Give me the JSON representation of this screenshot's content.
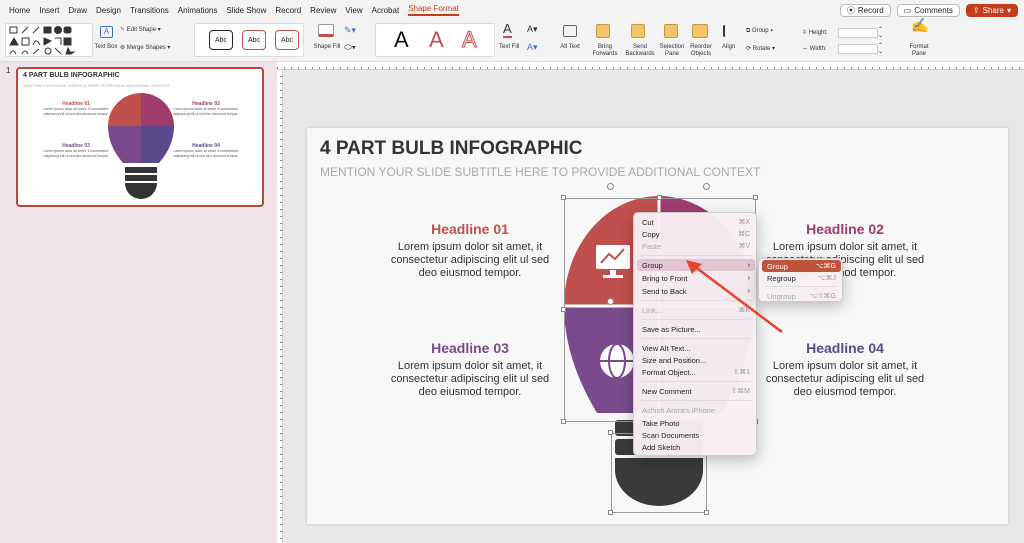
{
  "tabs": [
    "Home",
    "Insert",
    "Draw",
    "Design",
    "Transitions",
    "Animations",
    "Slide Show",
    "Record",
    "Review",
    "View",
    "Acrobat",
    "Shape Format"
  ],
  "top_right": {
    "record": "Record",
    "comments": "Comments",
    "share": "Share"
  },
  "ribbon": {
    "text_box": "Text Box",
    "edit_shape": "Edit Shape",
    "merge_shapes": "Merge Shapes",
    "style_sample": "Abc",
    "shape_fill": "Shape Fill",
    "text_fill": "Text Fill",
    "alt_text": "Alt Text",
    "bring_forwards": "Bring Forwards",
    "send_backwards": "Send Backwards",
    "selection_pane": "Selection Pane",
    "reorder_objects": "Reorder Objects",
    "align": "Align",
    "group": "Group",
    "rotate": "Rotate",
    "height": "Height:",
    "width": "Width:",
    "format_pane": "Format Pane",
    "wordart_a": "A"
  },
  "slide_number": "1",
  "slide": {
    "title": "4 PART BULB INFOGRAPHIC",
    "subtitle": "MENTION YOUR SLIDE SUBTITLE HERE TO PROVIDE ADDITIONAL CONTEXT",
    "body": "Lorem ipsum dolor sit amet, it consectetur adipiscing elit ul sed deo eiusmod tempor.",
    "h1": "Headline 01",
    "h2": "Headline 02",
    "h3": "Headline 03",
    "h4": "Headline 04"
  },
  "colors": {
    "h1": "#c0504d",
    "h2": "#9e3c6e",
    "h3": "#7a4a8c",
    "h4": "#5a4a8c",
    "accent": "#c43e1c"
  },
  "context_menu": [
    {
      "label": "Cut",
      "shortcut": "⌘X",
      "disabled": false
    },
    {
      "label": "Copy",
      "shortcut": "⌘C",
      "disabled": false
    },
    {
      "label": "Paste",
      "shortcut": "⌘V",
      "disabled": true
    },
    {
      "label": "Group",
      "shortcut": "›",
      "disabled": false
    },
    {
      "label": "Bring to Front",
      "shortcut": "›",
      "disabled": false
    },
    {
      "label": "Send to Back",
      "shortcut": "›",
      "disabled": false
    },
    {
      "label": "Link...",
      "shortcut": "⌘K",
      "disabled": true
    },
    {
      "label": "Save as Picture...",
      "shortcut": "",
      "disabled": false
    },
    {
      "label": "View Alt Text...",
      "shortcut": "",
      "disabled": false
    },
    {
      "label": "Size and Position...",
      "shortcut": "",
      "disabled": false
    },
    {
      "label": "Format Object...",
      "shortcut": "⇧⌘1",
      "disabled": false
    },
    {
      "label": "New Comment",
      "shortcut": "⇧⌘M",
      "disabled": false
    },
    {
      "label": "Ashish Arora's iPhone",
      "shortcut": "",
      "disabled": true
    },
    {
      "label": "Take Photo",
      "shortcut": "",
      "disabled": false
    },
    {
      "label": "Scan Documents",
      "shortcut": "",
      "disabled": false
    },
    {
      "label": "Add Sketch",
      "shortcut": "",
      "disabled": false
    }
  ],
  "submenu": [
    {
      "label": "Group",
      "shortcut": "⌥⌘G"
    },
    {
      "label": "Regroup",
      "shortcut": "⌥⌘J"
    },
    {
      "label": "Ungroup",
      "shortcut": "⌥⇧⌘G"
    }
  ]
}
